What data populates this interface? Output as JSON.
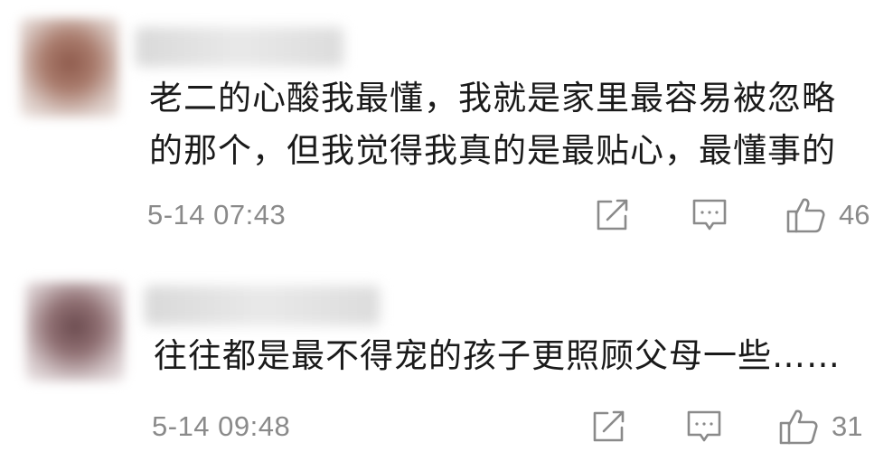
{
  "comments": [
    {
      "text_lines": [
        "老二的心酸我最懂，我就是家里最容易被忽略",
        "的那个，但我觉得我真的是最贴心，最懂事的"
      ],
      "timestamp": "5-14 07:43",
      "likes": "46",
      "icons": [
        "share-icon",
        "comment-bubble-icon",
        "thumbs-up-icon"
      ]
    },
    {
      "text_lines": [
        "往往都是最不得宠的孩子更照顾父母一些……"
      ],
      "timestamp": "5-14 09:48",
      "likes": "31",
      "icons": [
        "share-icon",
        "comment-bubble-icon",
        "thumbs-up-icon"
      ]
    }
  ],
  "colors": {
    "text": "#1a1a1a",
    "meta": "#8a8a8a",
    "icon_stroke": "#8a8a8a"
  }
}
